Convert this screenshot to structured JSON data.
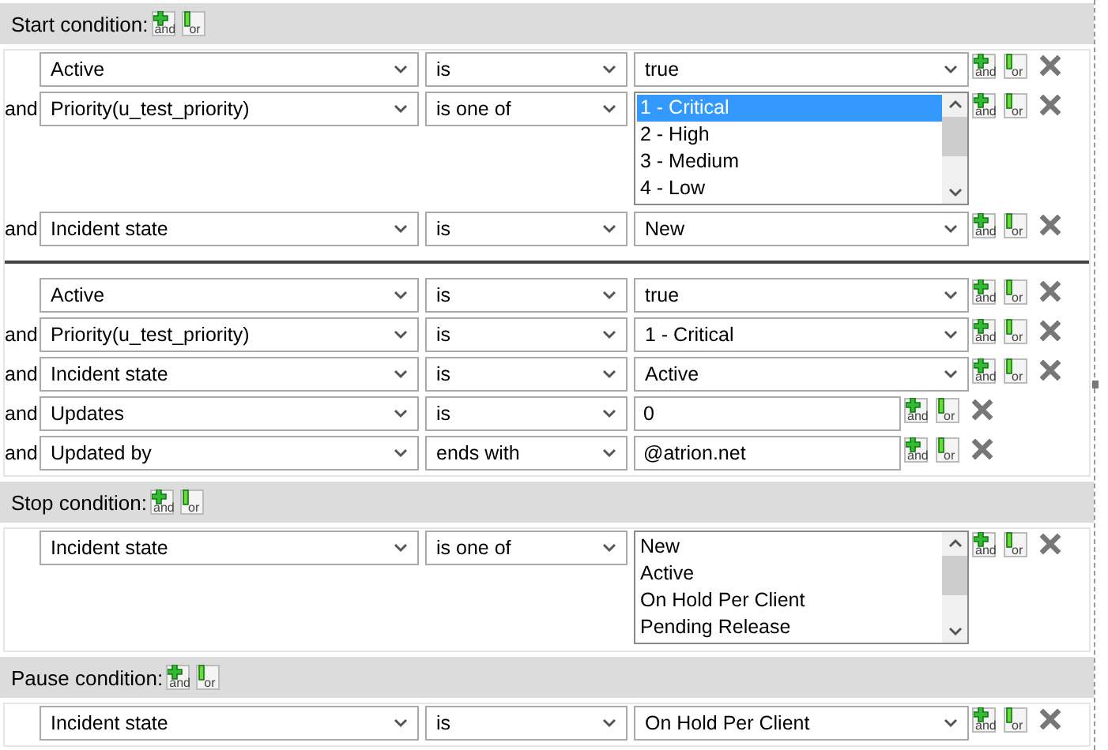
{
  "sections": [
    {
      "title": "Start condition:",
      "buttons": [
        "and",
        "or"
      ],
      "groups": [
        {
          "rows": [
            {
              "prefix": "",
              "field": "Active",
              "operator": "is",
              "value": {
                "kind": "select",
                "text": "true"
              },
              "buttons": [
                "and",
                "or"
              ]
            },
            {
              "prefix": "and",
              "field": "Priority(u_test_priority)",
              "operator": "is one of",
              "value": {
                "kind": "list",
                "options": [
                  {
                    "label": "1 - Critical",
                    "selected": true
                  },
                  {
                    "label": "2 - High",
                    "selected": false
                  },
                  {
                    "label": "3 - Medium",
                    "selected": false
                  },
                  {
                    "label": "4 - Low",
                    "selected": false
                  }
                ]
              },
              "buttons": [
                "and",
                "or"
              ]
            },
            {
              "prefix": "and",
              "field": "Incident state",
              "operator": "is",
              "value": {
                "kind": "select",
                "text": "New"
              },
              "buttons": [
                "and",
                "or"
              ]
            }
          ]
        },
        {
          "rows": [
            {
              "prefix": "",
              "field": "Active",
              "operator": "is",
              "value": {
                "kind": "select",
                "text": "true"
              },
              "buttons": [
                "and",
                "or"
              ]
            },
            {
              "prefix": "and",
              "field": "Priority(u_test_priority)",
              "operator": "is",
              "value": {
                "kind": "select",
                "text": "1 - Critical"
              },
              "buttons": [
                "and",
                "or"
              ]
            },
            {
              "prefix": "and",
              "field": "Incident state",
              "operator": "is",
              "value": {
                "kind": "select",
                "text": "Active"
              },
              "buttons": [
                "and",
                "or"
              ]
            },
            {
              "prefix": "and",
              "field": "Updates",
              "operator": "is",
              "value": {
                "kind": "input",
                "text": "0"
              },
              "buttons": [
                "and",
                "or"
              ]
            },
            {
              "prefix": "and",
              "field": "Updated by",
              "operator": "ends with",
              "value": {
                "kind": "input",
                "text": "@atrion.net"
              },
              "buttons": [
                "and",
                "or"
              ]
            }
          ]
        }
      ]
    },
    {
      "title": "Stop condition:",
      "buttons": [
        "and",
        "or"
      ],
      "groups": [
        {
          "rows": [
            {
              "prefix": "",
              "field": "Incident state",
              "operator": "is one of",
              "value": {
                "kind": "list",
                "options": [
                  {
                    "label": "New",
                    "selected": false
                  },
                  {
                    "label": "Active",
                    "selected": false
                  },
                  {
                    "label": "On Hold Per Client",
                    "selected": false
                  },
                  {
                    "label": "Pending Release",
                    "selected": false
                  }
                ]
              },
              "buttons": [
                "and",
                "or"
              ]
            }
          ]
        }
      ]
    },
    {
      "title": "Pause condition:",
      "buttons": [
        "and",
        "or"
      ],
      "groups": [
        {
          "rows": [
            {
              "prefix": "",
              "field": "Incident state",
              "operator": "is",
              "value": {
                "kind": "select",
                "text": "On Hold Per Client"
              },
              "buttons": [
                "and",
                "or"
              ]
            }
          ]
        }
      ]
    }
  ]
}
